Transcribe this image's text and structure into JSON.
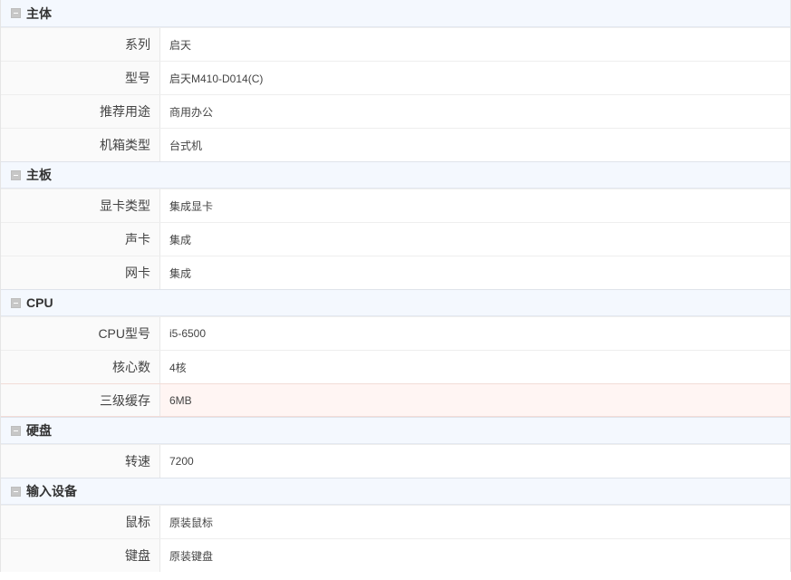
{
  "sections": [
    {
      "title": "主体",
      "rows": [
        {
          "label": "系列",
          "value": "启天"
        },
        {
          "label": "型号",
          "value": "启天M410-D014(C)"
        },
        {
          "label": "推荐用途",
          "value": "商用办公"
        },
        {
          "label": "机箱类型",
          "value": "台式机"
        }
      ]
    },
    {
      "title": "主板",
      "rows": [
        {
          "label": "显卡类型",
          "value": "集成显卡"
        },
        {
          "label": "声卡",
          "value": "集成"
        },
        {
          "label": "网卡",
          "value": "集成"
        }
      ]
    },
    {
      "title": "CPU",
      "rows": [
        {
          "label": "CPU型号",
          "value": "i5-6500"
        },
        {
          "label": "核心数",
          "value": "4核"
        },
        {
          "label": "三级缓存",
          "value": "6MB"
        }
      ]
    },
    {
      "title": "硬盘",
      "rows": [
        {
          "label": "转速",
          "value": "7200"
        }
      ]
    },
    {
      "title": "输入设备",
      "rows": [
        {
          "label": "鼠标",
          "value": "原装鼠标"
        },
        {
          "label": "键盘",
          "value": "原装键盘"
        }
      ]
    }
  ],
  "highlighted_row": "三级缓存",
  "colors": {
    "header_bg": "#f4f8fe",
    "label_bg": "#fafafa",
    "highlight_bg": "#fff5f3",
    "icon_gray": "#c7c7c7"
  }
}
